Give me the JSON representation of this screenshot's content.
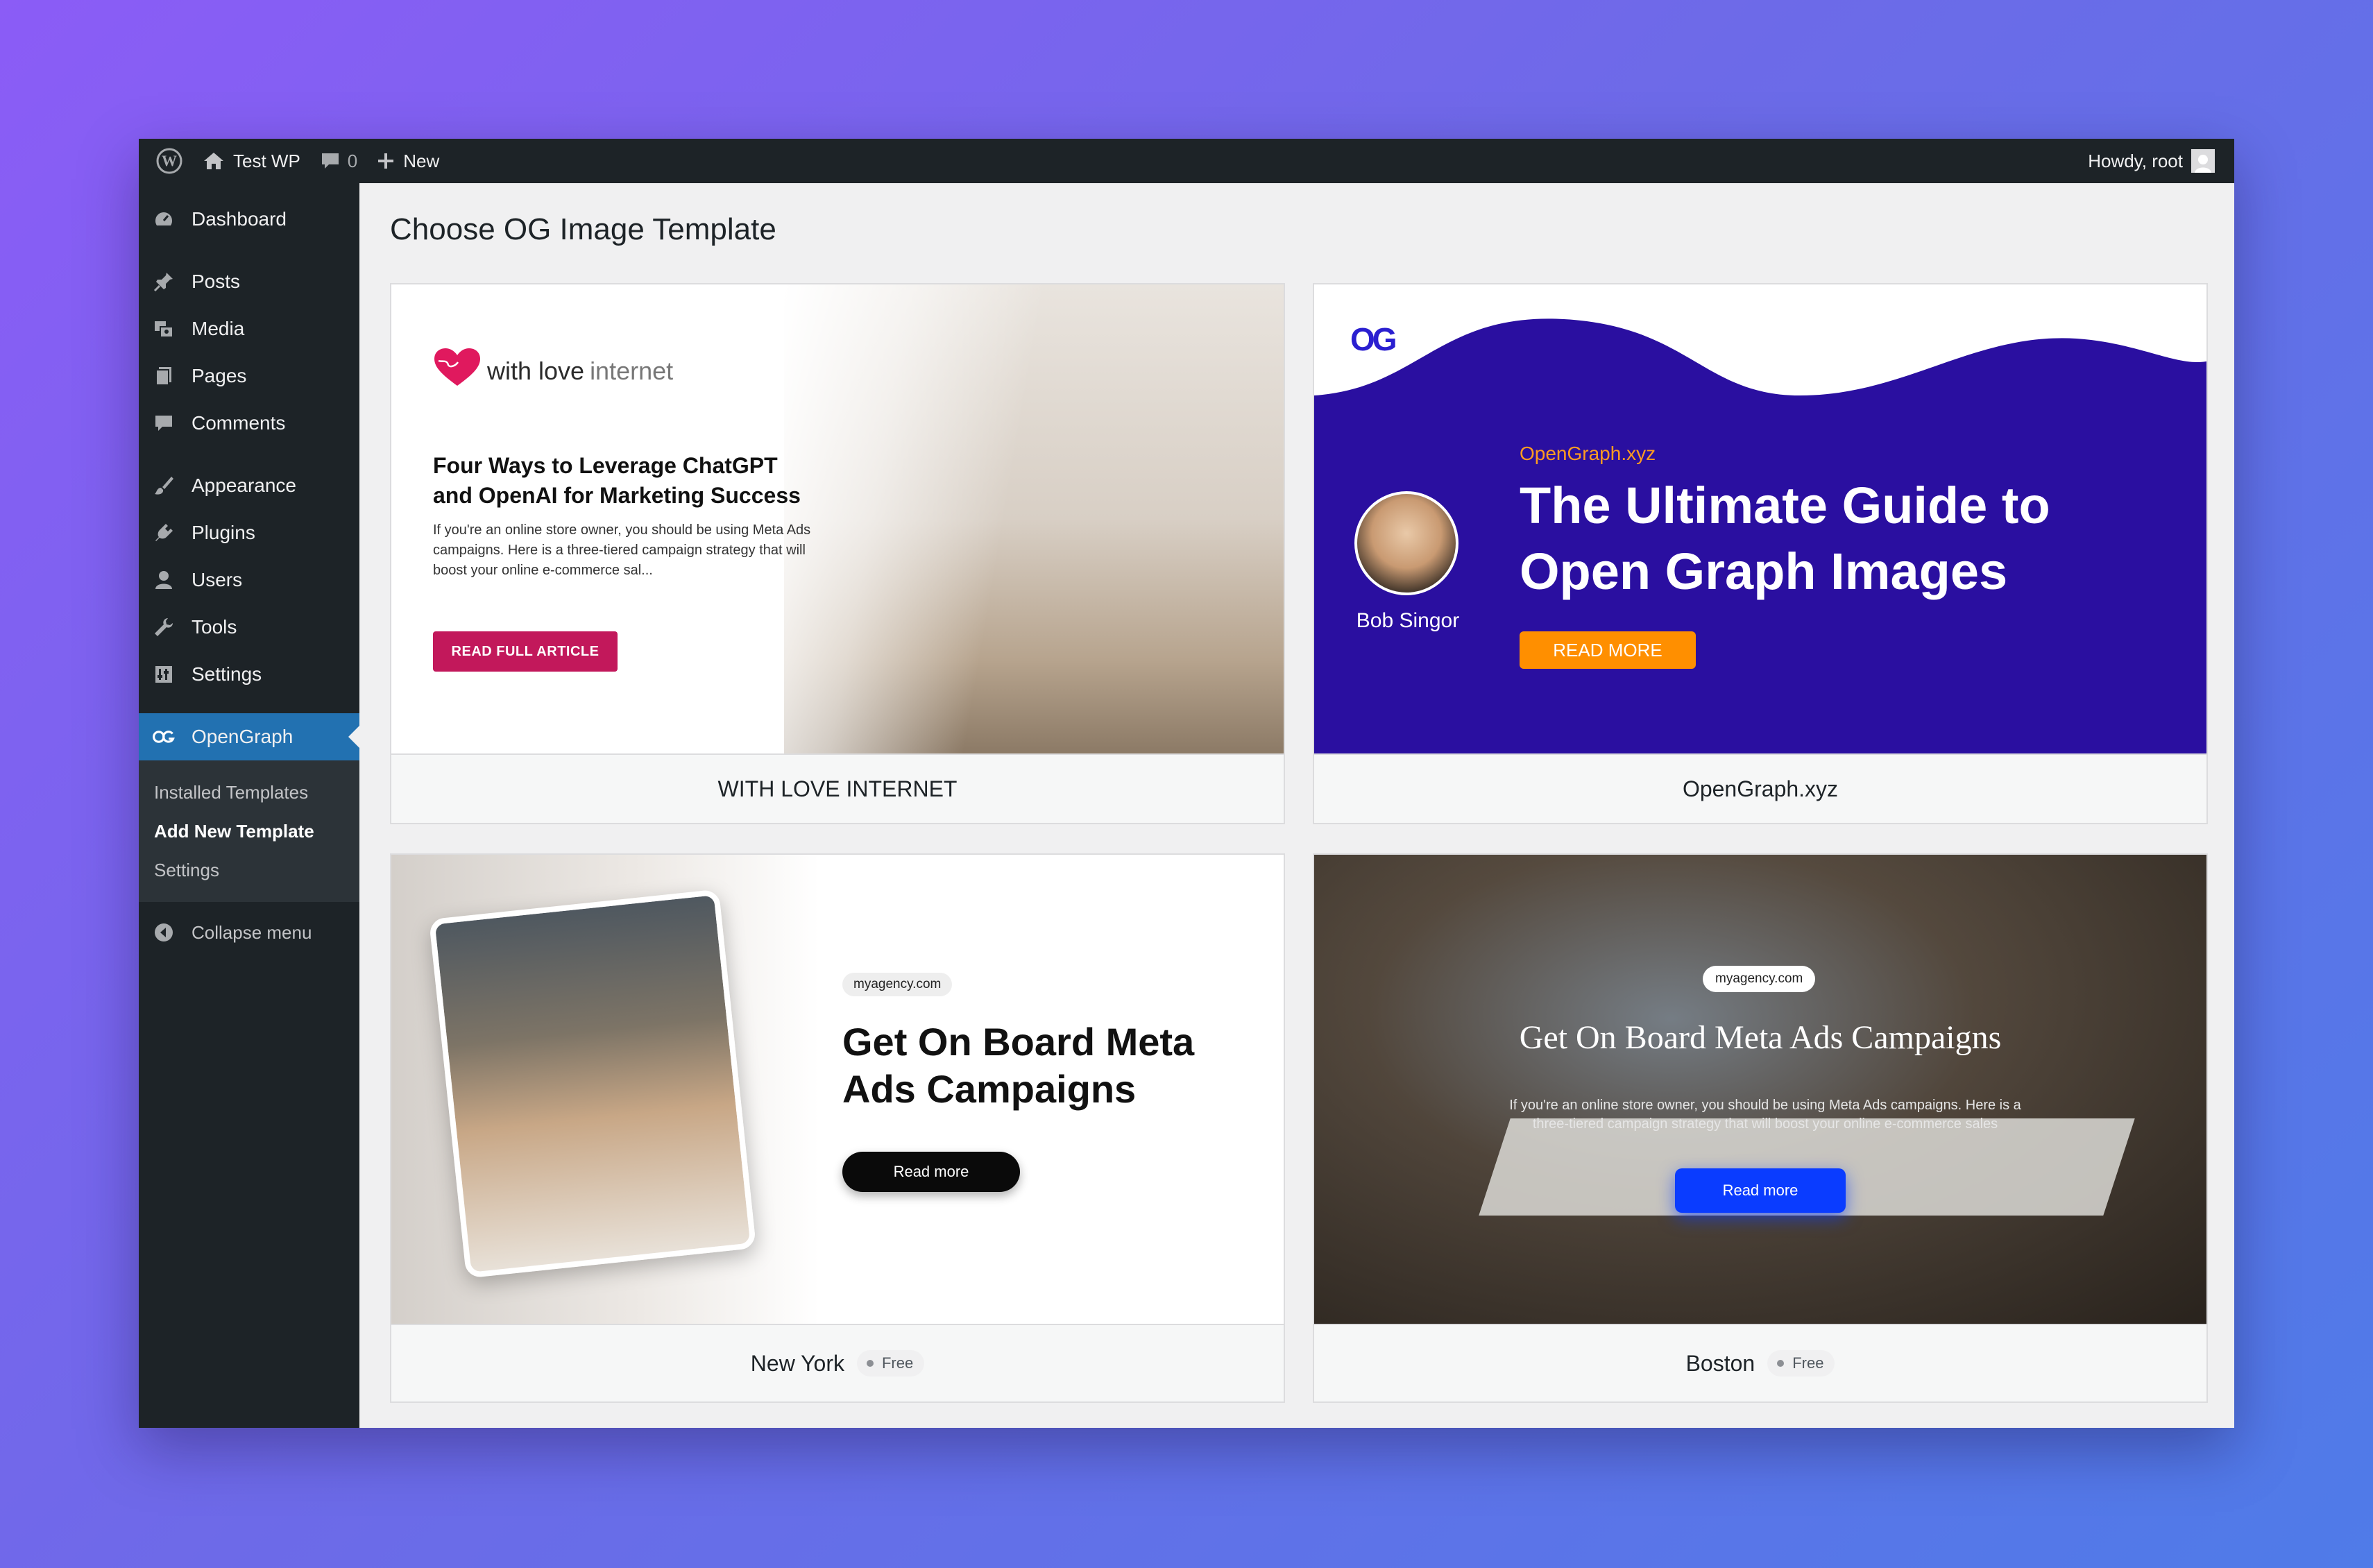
{
  "adminbar": {
    "site_name": "Test WP",
    "comments_count": "0",
    "new_label": "New",
    "howdy": "Howdy, root"
  },
  "sidebar": {
    "items": [
      {
        "label": "Dashboard",
        "icon": "dashboard-icon"
      },
      {
        "label": "Posts",
        "icon": "pin-icon"
      },
      {
        "label": "Media",
        "icon": "media-icon"
      },
      {
        "label": "Pages",
        "icon": "pages-icon"
      },
      {
        "label": "Comments",
        "icon": "comment-icon"
      },
      {
        "label": "Appearance",
        "icon": "brush-icon"
      },
      {
        "label": "Plugins",
        "icon": "plugin-icon"
      },
      {
        "label": "Users",
        "icon": "user-icon"
      },
      {
        "label": "Tools",
        "icon": "wrench-icon"
      },
      {
        "label": "Settings",
        "icon": "settings-icon"
      },
      {
        "label": "OpenGraph",
        "icon": "og-icon"
      }
    ],
    "submenu": [
      "Installed Templates",
      "Add New Template",
      "Settings"
    ],
    "collapse": "Collapse menu"
  },
  "main": {
    "title": "Choose OG Image Template",
    "cards": [
      {
        "name": "WITH LOVE INTERNET",
        "preview": {
          "logo_bold": "with love",
          "logo_light": "internet",
          "title": "Four Ways to Leverage ChatGPT and OpenAI for Marketing Success",
          "description": "If you're an online store owner, you should be using Meta Ads campaigns. Here is a three-tiered campaign strategy that will boost your online e-commerce sal...",
          "button": "READ FULL ARTICLE"
        }
      },
      {
        "name": "OpenGraph.xyz",
        "preview": {
          "logo": "OG",
          "author": "Bob Singor",
          "site": "OpenGraph.xyz",
          "title": "The Ultimate Guide to Open Graph Images",
          "button": "READ MORE"
        }
      },
      {
        "name": "New York",
        "badge": "Free",
        "preview": {
          "domain": "myagency.com",
          "title": "Get On Board Meta Ads Campaigns",
          "button": "Read more"
        }
      },
      {
        "name": "Boston",
        "badge": "Free",
        "preview": {
          "domain": "myagency.com",
          "title": "Get On Board Meta Ads Campaigns",
          "description": "If you're an online store owner, you should be using Meta Ads campaigns. Here is a three-tiered campaign strategy that will boost your online e-commerce sales",
          "button": "Read more"
        }
      }
    ]
  },
  "colors": {
    "admin_dark": "#1d2327",
    "wp_blue": "#2271b1",
    "og_purple": "#2a0fa0",
    "og_orange": "#ff8f00",
    "love_pink": "#c2185b",
    "boston_blue": "#0a3cff"
  }
}
